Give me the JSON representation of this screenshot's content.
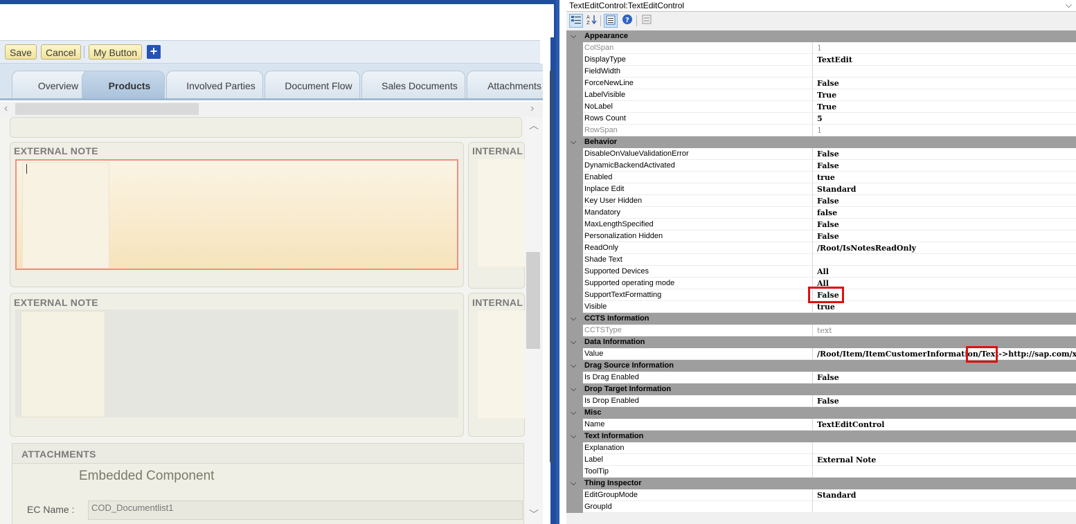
{
  "designer": {
    "toolbar": {
      "save_label": "Save",
      "cancel_label": "Cancel",
      "my_button_label": "My Button",
      "plus_label": "+"
    },
    "tabs": [
      {
        "label": "Overview",
        "active": false
      },
      {
        "label": "Products",
        "active": true
      },
      {
        "label": "Involved Parties",
        "active": false
      },
      {
        "label": "Document Flow",
        "active": false
      },
      {
        "label": "Sales Documents",
        "active": false
      },
      {
        "label": "Attachments",
        "active": false
      }
    ],
    "sections": {
      "external_note_1": "EXTERNAL NOTE",
      "internal_note_1": "INTERNAL",
      "external_note_2": "EXTERNAL NOTE",
      "internal_note_2": "INTERNAL",
      "attachments": "ATTACHMENTS",
      "embedded_component": "Embedded Component",
      "ec_name_label": "EC Name :",
      "ec_name_value": "COD_Documentlist1"
    }
  },
  "properties": {
    "object_selector": "TextEditControl:TextEditControl",
    "toolbar_icons": [
      "categorized-icon",
      "alphabetical-icon",
      "properties-icon",
      "help-icon",
      "property-pages-icon"
    ],
    "categories": [
      {
        "name": "Appearance",
        "props": [
          {
            "name": "ColSpan",
            "value": "1",
            "dim": true
          },
          {
            "name": "DisplayType",
            "value": "TextEdit"
          },
          {
            "name": "FieldWidth",
            "value": ""
          },
          {
            "name": "ForceNewLine",
            "value": "False"
          },
          {
            "name": "LabelVisible",
            "value": "True"
          },
          {
            "name": "NoLabel",
            "value": "True"
          },
          {
            "name": "Rows Count",
            "value": "5"
          },
          {
            "name": "RowSpan",
            "value": "1",
            "dim": true
          }
        ]
      },
      {
        "name": "Behavior",
        "props": [
          {
            "name": "DisableOnValueValidationError",
            "value": "False"
          },
          {
            "name": "DynamicBackendActivated",
            "value": "False"
          },
          {
            "name": "Enabled",
            "value": "true"
          },
          {
            "name": "Inplace Edit",
            "value": "Standard"
          },
          {
            "name": "Key User Hidden",
            "value": "False"
          },
          {
            "name": "Mandatory",
            "value": "false"
          },
          {
            "name": "MaxLengthSpecified",
            "value": "False"
          },
          {
            "name": "Personalization Hidden",
            "value": "False"
          },
          {
            "name": "ReadOnly",
            "value": "/Root/IsNotesReadOnly"
          },
          {
            "name": "Shade Text",
            "value": ""
          },
          {
            "name": "Supported Devices",
            "value": "All"
          },
          {
            "name": "Supported operating mode",
            "value": "All"
          },
          {
            "name": "SupportTextFormatting",
            "value": "False"
          },
          {
            "name": "Visible",
            "value": "true"
          }
        ]
      },
      {
        "name": "CCTS Information",
        "props": [
          {
            "name": "CCTSType",
            "value": "text",
            "dim": true
          }
        ]
      },
      {
        "name": "Data Information",
        "props": [
          {
            "name": "Value",
            "value": "/Root/Item/ItemCustomerInformation/Text->http://sap.com/xi"
          }
        ]
      },
      {
        "name": "Drag Source Information",
        "props": [
          {
            "name": "Is Drag Enabled",
            "value": "False"
          }
        ]
      },
      {
        "name": "Drop Target Information",
        "props": [
          {
            "name": "Is Drop Enabled",
            "value": "False"
          }
        ]
      },
      {
        "name": "Misc",
        "props": [
          {
            "name": "Name",
            "value": "TextEditControl"
          }
        ]
      },
      {
        "name": "Text Information",
        "props": [
          {
            "name": "Explanation",
            "value": ""
          },
          {
            "name": "Label",
            "value": "External Note"
          },
          {
            "name": "ToolTip",
            "value": ""
          }
        ]
      },
      {
        "name": "Thing Inspector",
        "props": [
          {
            "name": "EditGroupMode",
            "value": "Standard"
          },
          {
            "name": "GroupId",
            "value": ""
          }
        ]
      }
    ]
  }
}
